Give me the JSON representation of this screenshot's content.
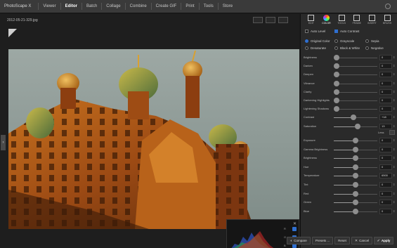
{
  "app": {
    "title": "PhotoScape X"
  },
  "menu": [
    "Viewer",
    "Editor",
    "Batch",
    "Collage",
    "Combine",
    "Create GIF",
    "Print",
    "Tools",
    "Store"
  ],
  "menu_active": "Editor",
  "file": {
    "name": "2012-05-21-329.jpg"
  },
  "tabs": [
    {
      "label": "EDIT",
      "icon": "edit-icon"
    },
    {
      "label": "COLOR",
      "icon": "color-wheel-icon"
    },
    {
      "label": "TOOLS",
      "icon": "tools-icon"
    },
    {
      "label": "FRAME",
      "icon": "frame-icon"
    },
    {
      "label": "INSERT",
      "icon": "insert-icon"
    },
    {
      "label": "BRUSH",
      "icon": "brush-icon"
    }
  ],
  "options": {
    "auto_level": "Auto Level",
    "auto_contrast": "Auto Contrast",
    "modes": [
      "Original Color",
      "Grayscale",
      "Sepia",
      "Desaturate",
      "Black & White",
      "Negative"
    ]
  },
  "sliders": [
    {
      "label": "Brightness",
      "value": "0",
      "pos": 0
    },
    {
      "label": "Darken",
      "value": "0",
      "pos": 0
    },
    {
      "label": "Deepen",
      "value": "0",
      "pos": 0
    },
    {
      "label": "Vibrance",
      "value": "0",
      "pos": 0
    },
    {
      "label": "Clarity",
      "value": "0",
      "pos": 0
    },
    {
      "label": "Darkening Highlights",
      "value": "0",
      "pos": 0
    },
    {
      "label": "Lightening Shadows",
      "value": "0",
      "pos": 0
    },
    {
      "label": "Contrast",
      "value": "+18",
      "pos": 0.45
    },
    {
      "label": "Saturation",
      "value": "13",
      "pos": 0.55
    }
  ],
  "less_label": "Less",
  "sliders2": [
    {
      "label": "Exposure",
      "value": "0",
      "pos": 0.5
    },
    {
      "label": "Gamma Brightness",
      "value": "0",
      "pos": 0.5
    },
    {
      "label": "Brightness",
      "value": "0",
      "pos": 0.5
    },
    {
      "label": "Hue",
      "value": "0",
      "pos": 0.5
    },
    {
      "label": "Temperature",
      "value": "6500",
      "pos": 0.5
    },
    {
      "label": "Tint",
      "value": "0",
      "pos": 0.5
    },
    {
      "label": "Red",
      "value": "0",
      "pos": 0.5
    },
    {
      "label": "Green",
      "value": "0",
      "pos": 0.5
    },
    {
      "label": "Blue",
      "value": "0",
      "pos": 0.5
    }
  ],
  "histogram": {
    "channels": [
      "R",
      "G",
      "B"
    ]
  },
  "actions": {
    "compare": "Compare",
    "presets": "Presets ...",
    "reset": "Reset",
    "cancel": "Cancel",
    "apply": "Apply"
  },
  "colors": {
    "accent": "#2f6fd0",
    "panel": "#2a2a2a",
    "menubar": "#3a3a3a"
  }
}
